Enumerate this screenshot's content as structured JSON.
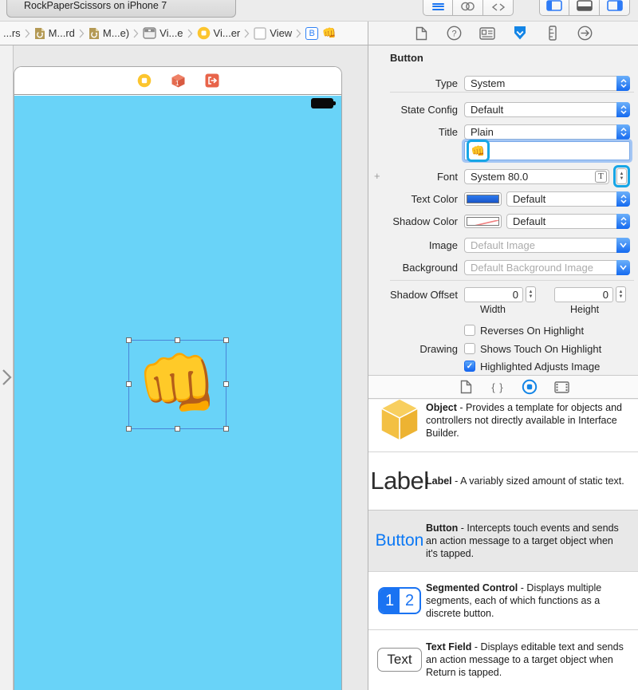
{
  "ui": {
    "checkmark": "✓",
    "snippet_icon": "{ }",
    "plus_icon": "+"
  },
  "toolbar": {
    "scheme_status": "RockPaperScissors on iPhone 7"
  },
  "jump_bar": {
    "items": [
      {
        "label": "...rs"
      },
      {
        "label": "M...rd"
      },
      {
        "label": "M...e)"
      },
      {
        "label": "Vi...e"
      },
      {
        "label": "Vi...er"
      },
      {
        "label": "View"
      },
      {
        "label": "👊",
        "icon_letter": "B"
      }
    ]
  },
  "canvas": {
    "button_emoji": "👊"
  },
  "inspector": {
    "header": "Button",
    "type": {
      "label": "Type",
      "value": "System"
    },
    "state_config": {
      "label": "State Config",
      "value": "Default"
    },
    "title": {
      "label": "Title",
      "value": "Plain"
    },
    "title_text": {
      "value": "👊"
    },
    "font": {
      "label": "Font",
      "value": "System 80.0",
      "t_button": "T"
    },
    "text_color": {
      "label": "Text Color",
      "value": "Default",
      "swatch": "#1f66e0"
    },
    "shadow_color": {
      "label": "Shadow Color",
      "value": "Default",
      "swatch": "#ffffff"
    },
    "image": {
      "label": "Image",
      "placeholder": "Default Image"
    },
    "background": {
      "label": "Background",
      "placeholder": "Default Background Image"
    },
    "shadow_offset": {
      "label": "Shadow Offset",
      "width_value": "0",
      "height_value": "0",
      "width_label": "Width",
      "height_label": "Height"
    },
    "drawing_label": "Drawing",
    "drawing_items": [
      {
        "label": "Reverses On Highlight",
        "checked": false
      },
      {
        "label": "Shows Touch On Highlight",
        "checked": false
      },
      {
        "label": "Highlighted Adjusts Image",
        "checked": true
      }
    ]
  },
  "library": {
    "items": [
      {
        "name": "Object",
        "desc": "- Provides a template for objects and controllers not directly available in Interface Builder.",
        "selected": false
      },
      {
        "name": "Label",
        "desc": "- A variably sized amount of static text.",
        "icon_text": "Label",
        "selected": false
      },
      {
        "name": "Button",
        "desc": "- Intercepts touch events and sends an action message to a target object when it's tapped.",
        "icon_text": "Button",
        "selected": true
      },
      {
        "name": "Segmented Control",
        "desc": "- Displays multiple segments, each of which functions as a discrete button.",
        "seg1": "1",
        "seg2": "2",
        "selected": false
      },
      {
        "name": "Text Field",
        "desc": "- Displays editable text and sends an action message to a target object when Return is tapped.",
        "icon_text": "Text",
        "selected": false
      }
    ]
  }
}
